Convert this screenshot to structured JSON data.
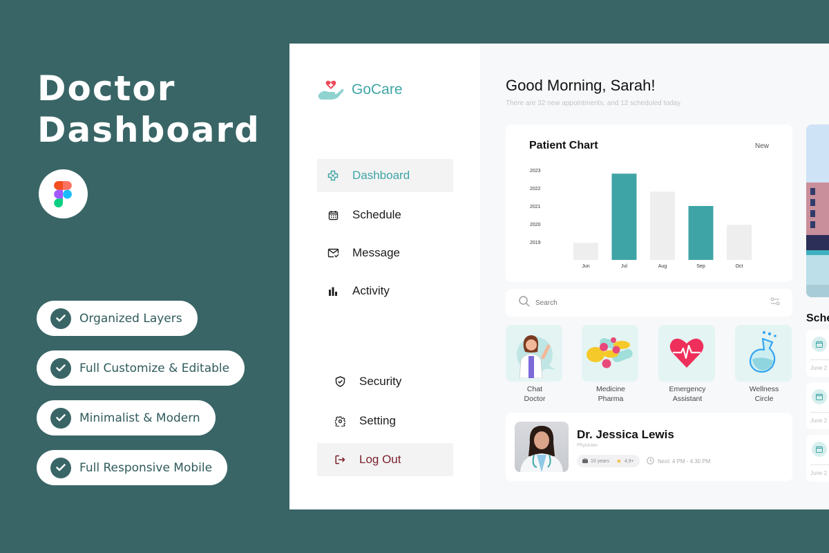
{
  "promo": {
    "title_line1": "Doctor",
    "title_line2": "Dashboard",
    "figma_icon": "figma-logo",
    "features": [
      "Organized Layers",
      "Full Customize & Editable",
      "Minimalist & Modern",
      "Full Responsive Mobile"
    ]
  },
  "app": {
    "brand": "GoCare",
    "brand_color": "#3fa4a6",
    "nav": [
      {
        "label": "Dashboard",
        "icon": "medical-cross-icon",
        "active": true
      },
      {
        "label": "Schedule",
        "icon": "calendar-icon"
      },
      {
        "label": "Message",
        "icon": "mail-check-icon"
      },
      {
        "label": "Activity",
        "icon": "bar-chart-icon"
      }
    ],
    "nav_bottom": [
      {
        "label": "Security",
        "icon": "shield-check-icon"
      },
      {
        "label": "Setting",
        "icon": "gear-icon"
      },
      {
        "label": "Log Out",
        "icon": "logout-icon"
      }
    ],
    "greeting": "Good Morning, Sarah!",
    "greeting_sub": "There are 32 new appointments, and 12 scheduled today",
    "search_placeholder": "Search",
    "services": [
      {
        "line1": "Chat",
        "line2": "Doctor"
      },
      {
        "line1": "Medicine",
        "line2": "Pharma"
      },
      {
        "line1": "Emergency",
        "line2": "Assistant"
      },
      {
        "line1": "Wellness",
        "line2": "Circle"
      }
    ],
    "doctor": {
      "name": "Dr. Jessica Lewis",
      "role": "Physician",
      "experience": "10 years",
      "rating": "4,9+",
      "next": "Next: 4 PM - 4.30 PM"
    },
    "schedule_title": "Schedule",
    "schedule_dates": [
      "June 2",
      "June 2",
      "June 2"
    ]
  },
  "chart_data": {
    "type": "bar",
    "title": "Patient Chart",
    "filter_label": "New",
    "categories": [
      "Jun",
      "Jul",
      "Aug",
      "Sep",
      "Oct"
    ],
    "values": [
      2018.95,
      2022.8,
      2021.8,
      2021.0,
      2019.95
    ],
    "highlighted": [
      false,
      true,
      false,
      true,
      false
    ],
    "yticks": [
      "2019",
      "2020",
      "2021",
      "2022",
      "2023"
    ],
    "ylim": [
      2018,
      2023
    ],
    "xlabel": "",
    "ylabel": "",
    "grid": false,
    "colors": {
      "highlight": "#3fa4a6",
      "normal": "#eeeeee"
    }
  }
}
